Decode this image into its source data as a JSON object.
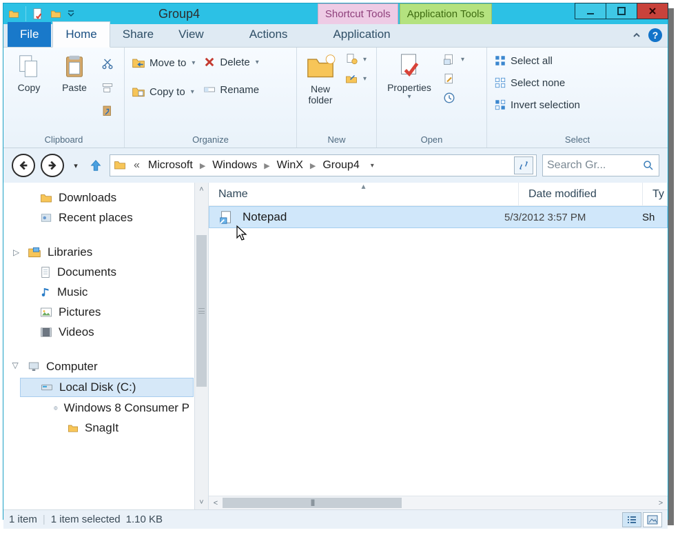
{
  "window": {
    "title": "Group4"
  },
  "toolTabs": {
    "shortcut": "Shortcut Tools",
    "application": "Application Tools"
  },
  "tabs": {
    "file": "File",
    "home": "Home",
    "share": "Share",
    "view": "View",
    "actions": "Actions",
    "applicationTab": "Application"
  },
  "ribbon": {
    "clipboard": {
      "group": "Clipboard",
      "copy": "Copy",
      "paste": "Paste"
    },
    "organize": {
      "group": "Organize",
      "moveTo": "Move to",
      "copyTo": "Copy to",
      "delete": "Delete",
      "rename": "Rename"
    },
    "new": {
      "group": "New",
      "newFolder": "New folder"
    },
    "open": {
      "group": "Open",
      "properties": "Properties"
    },
    "select": {
      "group": "Select",
      "selectAll": "Select all",
      "selectNone": "Select none",
      "invert": "Invert selection"
    }
  },
  "breadcrumbs": [
    "Microsoft",
    "Windows",
    "WinX",
    "Group4"
  ],
  "search": {
    "placeholder": "Search Gr..."
  },
  "nav": {
    "downloads": "Downloads",
    "recent": "Recent places",
    "libraries": "Libraries",
    "documents": "Documents",
    "music": "Music",
    "pictures": "Pictures",
    "videos": "Videos",
    "computer": "Computer",
    "localDisk": "Local Disk (C:)",
    "win8": "Windows 8 Consumer P",
    "snagit": "SnagIt"
  },
  "columns": {
    "name": "Name",
    "modified": "Date modified",
    "type": "Ty"
  },
  "files": [
    {
      "name": "Notepad",
      "modified": "5/3/2012 3:57 PM",
      "type": "Sh"
    }
  ],
  "status": {
    "count": "1 item",
    "selection": "1 item selected",
    "size": "1.10 KB"
  }
}
